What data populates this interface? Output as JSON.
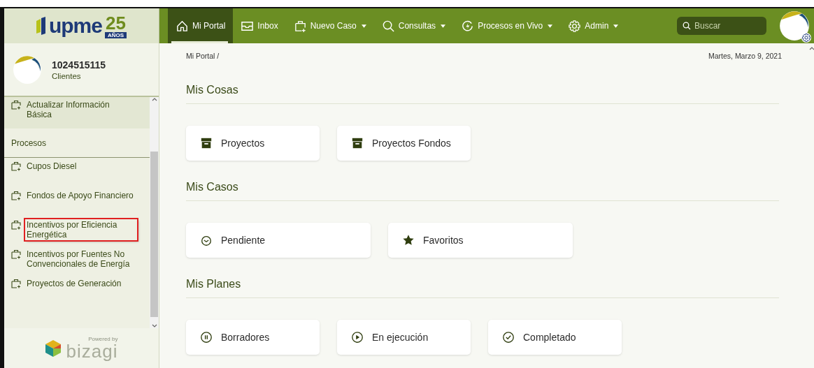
{
  "logo": {
    "text": "upme",
    "number": "25",
    "tag": "AÑOS"
  },
  "nav": [
    {
      "label": "Mi Portal",
      "kind": "home",
      "dropdown": false,
      "selected": true
    },
    {
      "label": "Inbox",
      "kind": "inbox",
      "dropdown": false,
      "selected": false
    },
    {
      "label": "Nuevo Caso",
      "kind": "case",
      "dropdown": true,
      "selected": false
    },
    {
      "label": "Consultas",
      "kind": "search",
      "dropdown": true,
      "selected": false
    },
    {
      "label": "Procesos en Vivo",
      "kind": "bolt",
      "dropdown": true,
      "selected": false
    },
    {
      "label": "Admin",
      "kind": "gear",
      "dropdown": true,
      "selected": false
    }
  ],
  "search": {
    "placeholder": "Buscar"
  },
  "profile": {
    "name": "1024515115",
    "role": "Clientes"
  },
  "sidebar": {
    "items": [
      {
        "kind": "item",
        "label": "Actualizar Información Básica",
        "highlighted": false,
        "current": true
      },
      {
        "kind": "section",
        "label": "Procesos"
      },
      {
        "kind": "item",
        "label": "Cupos Diesel",
        "highlighted": false,
        "current": false
      },
      {
        "kind": "item",
        "label": "Fondos de Apoyo Financiero",
        "highlighted": false,
        "current": false
      },
      {
        "kind": "item",
        "label": "Incentivos por Eficiencia Energética",
        "highlighted": true,
        "current": false
      },
      {
        "kind": "item",
        "label": "Incentivos por Fuentes No Convencionales de Energía",
        "highlighted": false,
        "current": false
      },
      {
        "kind": "item",
        "label": "Proyectos de Generación",
        "highlighted": false,
        "current": false
      }
    ]
  },
  "footer": {
    "powered": "Powered by",
    "brand": "bizagi"
  },
  "breadcrumb": "Mi Portal /",
  "date": "Martes, Marzo 9, 2021",
  "sections": [
    {
      "title": "Mis Cosas",
      "cards": [
        {
          "label": "Proyectos",
          "kind": "archive"
        },
        {
          "label": "Proyectos Fondos",
          "kind": "archive"
        }
      ]
    },
    {
      "title": "Mis Casos",
      "cards": [
        {
          "label": "Pendiente",
          "kind": "clock"
        },
        {
          "label": "Favoritos",
          "kind": "star"
        }
      ]
    },
    {
      "title": "Mis Planes",
      "cards": [
        {
          "label": "Borradores",
          "kind": "pause"
        },
        {
          "label": "En ejecución",
          "kind": "play"
        },
        {
          "label": "Completado",
          "kind": "check"
        }
      ]
    }
  ]
}
